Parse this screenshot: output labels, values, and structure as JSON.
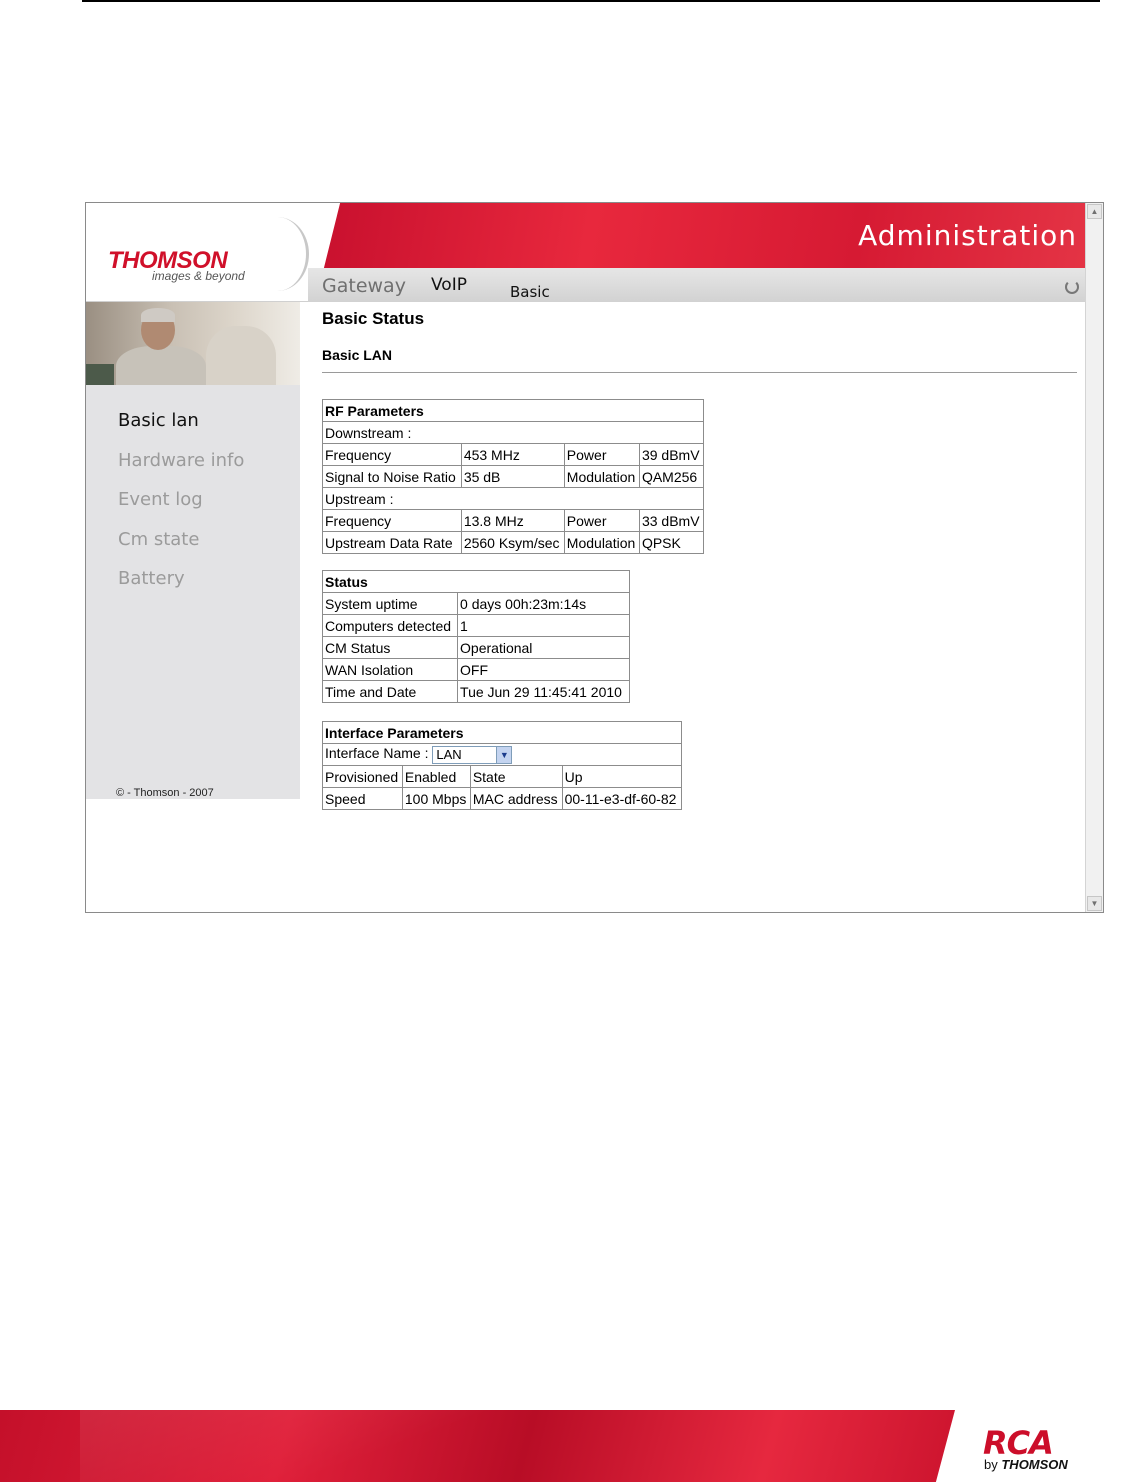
{
  "header": {
    "brand": "THOMSON",
    "tagline": "images & beyond",
    "title": "Administration"
  },
  "nav": {
    "gateway": "Gateway",
    "voip": "VoIP",
    "basic": "Basic"
  },
  "sidebar": {
    "items": [
      {
        "label": "Basic lan",
        "active": true
      },
      {
        "label": "Hardware info",
        "active": false
      },
      {
        "label": "Event log",
        "active": false
      },
      {
        "label": "Cm state",
        "active": false
      },
      {
        "label": "Battery",
        "active": false
      }
    ],
    "copyright": "© - Thomson - 2007"
  },
  "main": {
    "title": "Basic Status",
    "section": "Basic LAN",
    "rf": {
      "header": "RF Parameters",
      "downstream_label": "Downstream :",
      "ds_freq_label": "Frequency",
      "ds_freq": "453 MHz",
      "ds_power_label": "Power",
      "ds_power": "39 dBmV",
      "ds_snr_label": "Signal to Noise Ratio",
      "ds_snr": "35 dB",
      "ds_mod_label": "Modulation",
      "ds_mod": "QAM256",
      "upstream_label": "Upstream :",
      "us_freq_label": "Frequency",
      "us_freq": "13.8 MHz",
      "us_power_label": "Power",
      "us_power": "33 dBmV",
      "us_rate_label": "Upstream Data Rate",
      "us_rate": "2560 Ksym/sec",
      "us_mod_label": "Modulation",
      "us_mod": "QPSK"
    },
    "status": {
      "header": "Status",
      "rows": [
        {
          "label": "System uptime",
          "value": "0 days 00h:23m:14s"
        },
        {
          "label": "Computers detected",
          "value": "1"
        },
        {
          "label": "CM Status",
          "value": "Operational"
        },
        {
          "label": "WAN Isolation",
          "value": "OFF"
        },
        {
          "label": "Time and Date",
          "value": "Tue Jun 29 11:45:41 2010"
        }
      ]
    },
    "iface": {
      "header": "Interface Parameters",
      "name_label": "Interface Name :",
      "name_value": "LAN",
      "provisioned_label": "Provisioned",
      "enabled_label": "Enabled",
      "state_label": "State",
      "state_value": "Up",
      "speed_label": "Speed",
      "speed_value": "100 Mbps",
      "mac_label": "MAC address",
      "mac_value": "00-11-e3-df-60-82"
    }
  },
  "footer": {
    "logo": "RCA",
    "by": "by",
    "by_brand": "THOMSON"
  }
}
